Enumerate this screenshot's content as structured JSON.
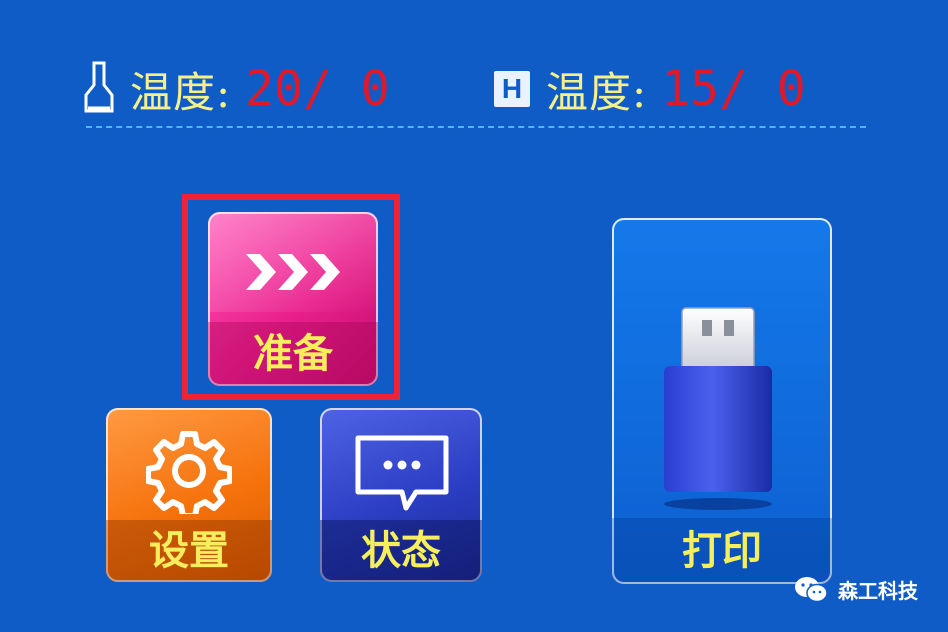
{
  "status": {
    "nozzle": {
      "icon": "nozzle-icon",
      "label": "温度:",
      "value": "20/ 0"
    },
    "bed": {
      "icon": "heated-bed-icon",
      "icon_text": "H",
      "label": "温度:",
      "value": "15/ 0"
    }
  },
  "menu": {
    "prepare": {
      "label": "准备",
      "icon": "triple-chevron-icon",
      "selected": true
    },
    "settings": {
      "label": "设置",
      "icon": "gear-icon"
    },
    "status": {
      "label": "状态",
      "icon": "message-bubble-icon"
    },
    "print": {
      "label": "打印",
      "icon": "usb-drive-icon"
    }
  },
  "watermark": {
    "text": "森工科技",
    "icon": "wechat-icon"
  },
  "colors": {
    "background": "#0f5cc7",
    "label_text": "#f6f08a",
    "value_text": "#e0192a",
    "selection": "#ef2333",
    "prepare_tile": "#e91f8c",
    "settings_tile": "#f5720c",
    "status_tile": "#2b3ec3",
    "print_tile": "#1479ea"
  }
}
